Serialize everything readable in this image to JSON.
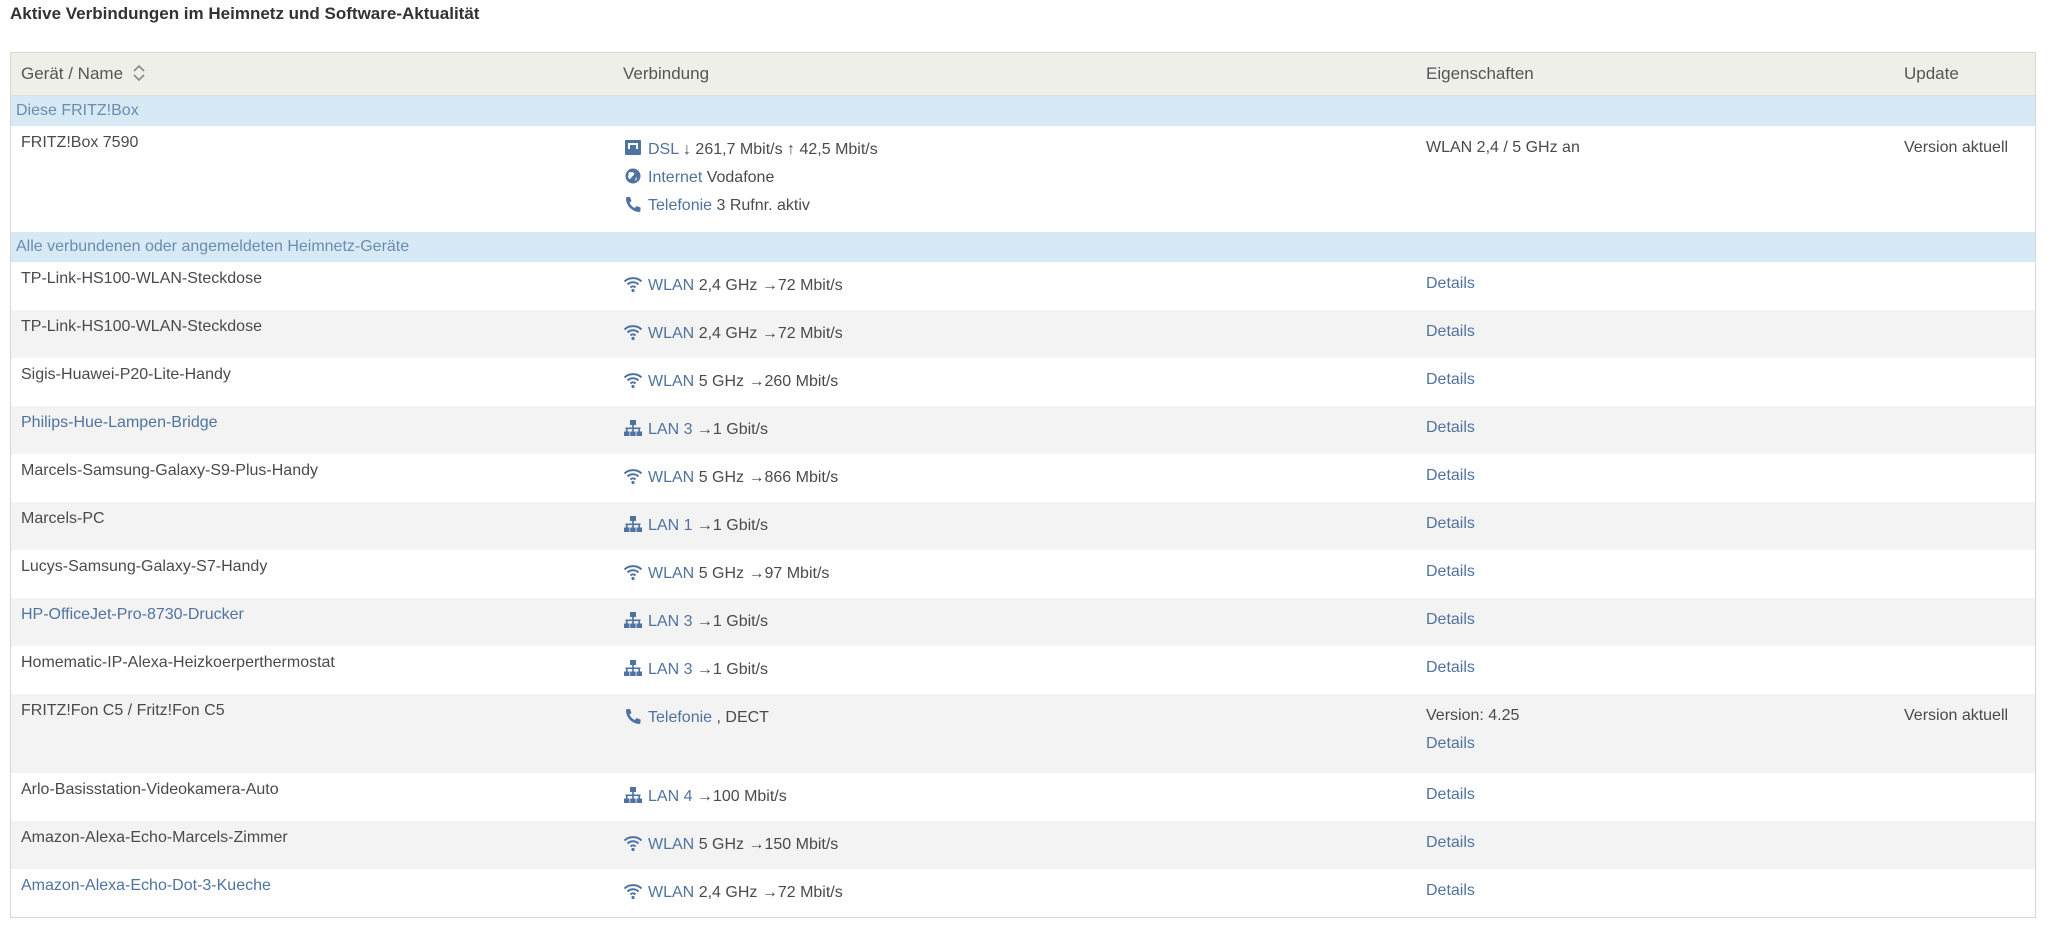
{
  "page_title": "Aktive Verbindungen im Heimnetz und Software-Aktualität",
  "columns": {
    "name": "Gerät / Name",
    "connection": "Verbindung",
    "properties": "Eigenschaften",
    "update": "Update"
  },
  "groups": {
    "fritzbox": "Diese FRITZ!Box",
    "devices": "Alle verbundenen oder angemeldeten Heimnetz-Geräte"
  },
  "fritzbox": {
    "name": "FRITZ!Box 7590",
    "dsl_label": "DSL",
    "dsl_value": "↓ 261,7 Mbit/s ↑ 42,5 Mbit/s",
    "internet_label": "Internet",
    "internet_value": "Vodafone",
    "telefonie_label": "Telefonie",
    "telefonie_value": "3 Rufnr. aktiv",
    "properties": "WLAN 2,4 / 5 GHz an",
    "update": "Version aktuell"
  },
  "devices": [
    {
      "name": "TP-Link-HS100-WLAN-Steckdose",
      "name_link": false,
      "icon": "wifi-icon",
      "conn_label": "WLAN",
      "conn_value": "2,4 GHz →72 Mbit/s",
      "details": "Details"
    },
    {
      "name": "TP-Link-HS100-WLAN-Steckdose",
      "name_link": false,
      "icon": "wifi-icon",
      "conn_label": "WLAN",
      "conn_value": "2,4 GHz →72 Mbit/s",
      "details": "Details"
    },
    {
      "name": "Sigis-Huawei-P20-Lite-Handy",
      "name_link": false,
      "icon": "wifi-icon",
      "conn_label": "WLAN",
      "conn_value": "5 GHz →260 Mbit/s",
      "details": "Details"
    },
    {
      "name": "Philips-Hue-Lampen-Bridge",
      "name_link": true,
      "icon": "lan-icon",
      "conn_label": "LAN 3",
      "conn_value": "→1 Gbit/s",
      "details": "Details"
    },
    {
      "name": "Marcels-Samsung-Galaxy-S9-Plus-Handy",
      "name_link": false,
      "icon": "wifi-icon",
      "conn_label": "WLAN",
      "conn_value": "5 GHz →866 Mbit/s",
      "details": "Details"
    },
    {
      "name": "Marcels-PC",
      "name_link": false,
      "icon": "lan-icon",
      "conn_label": "LAN 1",
      "conn_value": "→1 Gbit/s",
      "details": "Details"
    },
    {
      "name": "Lucys-Samsung-Galaxy-S7-Handy",
      "name_link": false,
      "icon": "wifi-icon",
      "conn_label": "WLAN",
      "conn_value": "5 GHz →97 Mbit/s",
      "details": "Details"
    },
    {
      "name": "HP-OfficeJet-Pro-8730-Drucker",
      "name_link": true,
      "icon": "lan-icon",
      "conn_label": "LAN 3",
      "conn_value": "→1 Gbit/s",
      "details": "Details"
    },
    {
      "name": "Homematic-IP-Alexa-Heizkoerperthermostat",
      "name_link": false,
      "icon": "lan-icon",
      "conn_label": "LAN 3",
      "conn_value": "→1 Gbit/s",
      "details": "Details"
    },
    {
      "name": "FRITZ!Fon C5 / Fritz!Fon C5",
      "name_link": false,
      "icon": "phone-icon",
      "conn_label": "Telefonie",
      "conn_value": ", DECT",
      "version": "Version: 4.25",
      "update": "Version aktuell",
      "details": "Details",
      "tall": true
    },
    {
      "name": "Arlo-Basisstation-Videokamera-Auto",
      "name_link": false,
      "icon": "lan-icon",
      "conn_label": "LAN 4",
      "conn_value": "→100 Mbit/s",
      "details": "Details"
    },
    {
      "name": "Amazon-Alexa-Echo-Marcels-Zimmer",
      "name_link": false,
      "icon": "wifi-icon",
      "conn_label": "WLAN",
      "conn_value": "5 GHz →150 Mbit/s",
      "details": "Details"
    },
    {
      "name": "Amazon-Alexa-Echo-Dot-3-Kueche",
      "name_link": true,
      "icon": "wifi-icon",
      "conn_label": "WLAN",
      "conn_value": "2,4 GHz →72 Mbit/s",
      "details": "Details"
    }
  ],
  "colors": {
    "link": "#4f73a0",
    "group_bg": "#d8e9f6",
    "header_bg": "#efefea",
    "row_alt": "#f3f3f3"
  }
}
